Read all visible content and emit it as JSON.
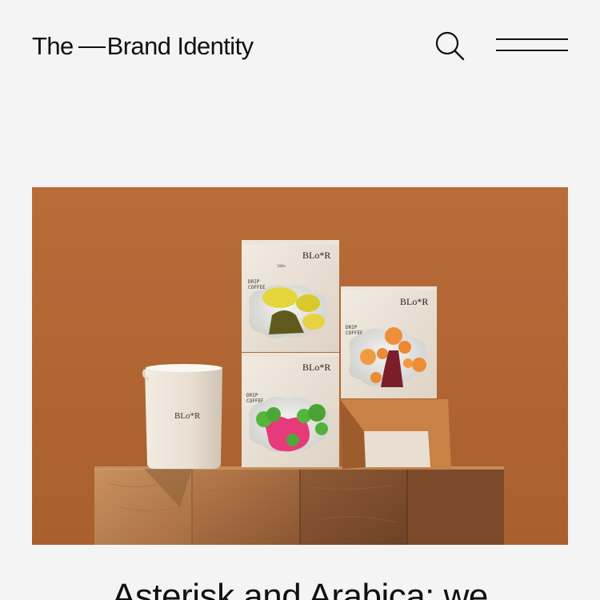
{
  "header": {
    "brand_part1": "The",
    "brand_part2": "Brand Identity",
    "search_icon": "search-icon",
    "menu_icon": "hamburger-menu-icon"
  },
  "hero": {
    "image": "Product photo of BLo*R drip coffee boxes and a cup on wooden blocks against an orange background",
    "product_brand": "BLo*R",
    "box_label": "DRIP COFFEE",
    "box_sub": "100% Arabica beans"
  },
  "article": {
    "headline": "Asterisk and Arabica: we"
  },
  "colors": {
    "page_bg": "#f4f4f4",
    "text": "#111111",
    "hero_bg": "#b36a37"
  }
}
